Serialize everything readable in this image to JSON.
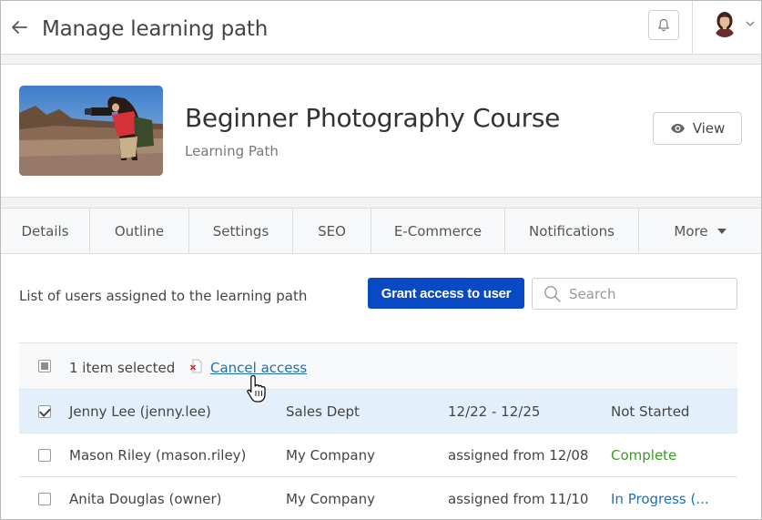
{
  "header": {
    "title": "Manage learning path"
  },
  "course": {
    "title": "Beginner Photography Course",
    "subtitle": "Learning Path",
    "view_label": "View"
  },
  "tabs": [
    {
      "label": "Details"
    },
    {
      "label": "Outline"
    },
    {
      "label": "Settings"
    },
    {
      "label": "SEO"
    },
    {
      "label": "E-Commerce"
    },
    {
      "label": "Notifications"
    },
    {
      "label": "More"
    }
  ],
  "toolbar": {
    "list_label": "List of users assigned to the learning path",
    "grant_label": "Grant access to user",
    "search_placeholder": "Search"
  },
  "selection": {
    "count_text": "1 item selected",
    "cancel_label": "Cancel access"
  },
  "rows": [
    {
      "name": "Jenny Lee (jenny.lee)",
      "dept": "Sales Dept",
      "dates": "12/22 - 12/25",
      "status": "Not Started",
      "selected": true
    },
    {
      "name": "Mason Riley (mason.riley)",
      "dept": "My Company",
      "dates": "assigned from 12/08",
      "status": "Complete",
      "selected": false
    },
    {
      "name": "Anita Douglas (owner)",
      "dept": "My Company",
      "dates": "assigned from 11/10",
      "status": "In Progress (...",
      "selected": false
    }
  ],
  "colors": {
    "primary": "#0a49c4",
    "link": "#1d6fb8",
    "complete": "#3c9a1f",
    "selected_row": "#e3f0fb"
  },
  "icons": [
    "back-arrow-icon",
    "bell-icon",
    "avatar",
    "chevron-down-icon",
    "eye-icon",
    "caret-down-icon",
    "search-icon",
    "cancel-doc-icon",
    "hand-cursor-icon"
  ]
}
